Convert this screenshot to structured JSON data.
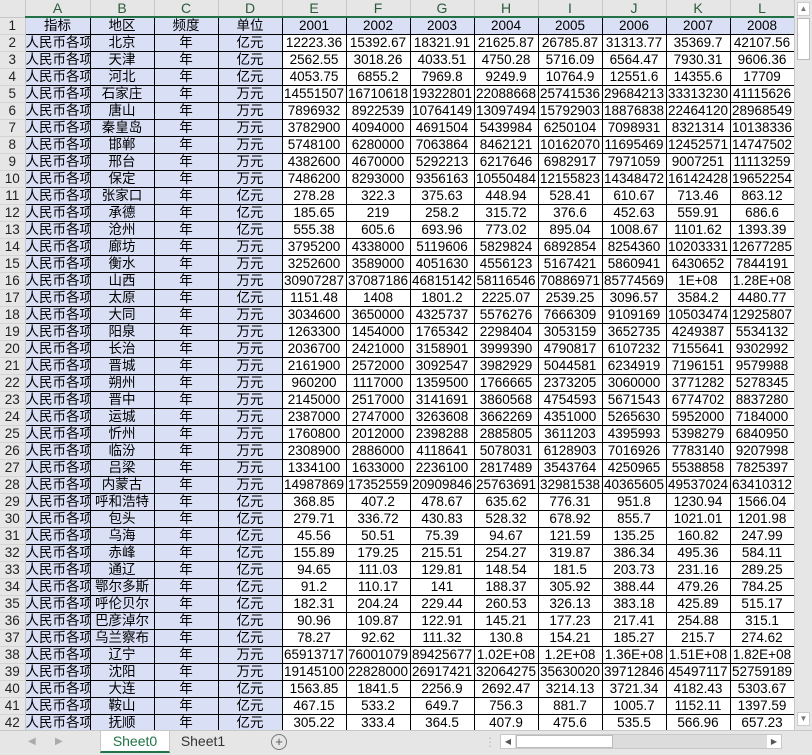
{
  "columns": [
    "A",
    "B",
    "C",
    "D",
    "E",
    "F",
    "G",
    "H",
    "I",
    "J",
    "K",
    "L"
  ],
  "header_row": [
    "指标",
    "地区",
    "频度",
    "单位",
    "2001",
    "2002",
    "2003",
    "2004",
    "2005",
    "2006",
    "2007",
    "2008"
  ],
  "rows": [
    [
      "人民币各项",
      "北京",
      "年",
      "亿元",
      "12223.36",
      "15392.67",
      "18321.91",
      "21625.87",
      "26785.87",
      "31313.77",
      "35369.7",
      "42107.56"
    ],
    [
      "人民币各项",
      "天津",
      "年",
      "亿元",
      "2562.55",
      "3018.26",
      "4033.51",
      "4750.28",
      "5716.09",
      "6564.47",
      "7930.31",
      "9606.36"
    ],
    [
      "人民币各项",
      "河北",
      "年",
      "亿元",
      "4053.75",
      "6855.2",
      "7969.8",
      "9249.9",
      "10764.9",
      "12551.6",
      "14355.6",
      "17709"
    ],
    [
      "人民币各项",
      "石家庄",
      "年",
      "万元",
      "14551507",
      "16710618",
      "19322801",
      "22088668",
      "25741536",
      "29684213",
      "33313230",
      "41115626"
    ],
    [
      "人民币各项",
      "唐山",
      "年",
      "万元",
      "7896932",
      "8922539",
      "10764149",
      "13097494",
      "15792903",
      "18876838",
      "22464120",
      "28968549"
    ],
    [
      "人民币各项",
      "秦皇岛",
      "年",
      "万元",
      "3782900",
      "4094000",
      "4691504",
      "5439984",
      "6250104",
      "7098931",
      "8321314",
      "10138336"
    ],
    [
      "人民币各项",
      "邯郸",
      "年",
      "万元",
      "5748100",
      "6280000",
      "7063864",
      "8462121",
      "10162070",
      "11695469",
      "12452571",
      "14747502"
    ],
    [
      "人民币各项",
      "邢台",
      "年",
      "万元",
      "4382600",
      "4670000",
      "5292213",
      "6217646",
      "6982917",
      "7971059",
      "9007251",
      "11113259"
    ],
    [
      "人民币各项",
      "保定",
      "年",
      "万元",
      "7486200",
      "8293000",
      "9356163",
      "10550484",
      "12155823",
      "14348472",
      "16142428",
      "19652254"
    ],
    [
      "人民币各项",
      "张家口",
      "年",
      "亿元",
      "278.28",
      "322.3",
      "375.63",
      "448.94",
      "528.41",
      "610.67",
      "713.46",
      "863.12"
    ],
    [
      "人民币各项",
      "承德",
      "年",
      "亿元",
      "185.65",
      "219",
      "258.2",
      "315.72",
      "376.6",
      "452.63",
      "559.91",
      "686.6"
    ],
    [
      "人民币各项",
      "沧州",
      "年",
      "亿元",
      "555.38",
      "605.6",
      "693.96",
      "773.02",
      "895.04",
      "1008.67",
      "1101.62",
      "1393.39"
    ],
    [
      "人民币各项",
      "廊坊",
      "年",
      "万元",
      "3795200",
      "4338000",
      "5119606",
      "5829824",
      "6892854",
      "8254360",
      "10203331",
      "12677285"
    ],
    [
      "人民币各项",
      "衡水",
      "年",
      "万元",
      "3252600",
      "3589000",
      "4051630",
      "4556123",
      "5167421",
      "5860941",
      "6430652",
      "7844191"
    ],
    [
      "人民币各项",
      "山西",
      "年",
      "万元",
      "30907287",
      "37087186",
      "46815142",
      "58116546",
      "70886971",
      "85774569",
      "1E+08",
      "1.28E+08"
    ],
    [
      "人民币各项",
      "太原",
      "年",
      "亿元",
      "1151.48",
      "1408",
      "1801.2",
      "2225.07",
      "2539.25",
      "3096.57",
      "3584.2",
      "4480.77"
    ],
    [
      "人民币各项",
      "大同",
      "年",
      "万元",
      "3034600",
      "3650000",
      "4325737",
      "5576276",
      "7666309",
      "9109169",
      "10503474",
      "12925807"
    ],
    [
      "人民币各项",
      "阳泉",
      "年",
      "万元",
      "1263300",
      "1454000",
      "1765342",
      "2298404",
      "3053159",
      "3652735",
      "4249387",
      "5534132"
    ],
    [
      "人民币各项",
      "长治",
      "年",
      "万元",
      "2036700",
      "2421000",
      "3158901",
      "3999390",
      "4790817",
      "6107232",
      "7155641",
      "9302992"
    ],
    [
      "人民币各项",
      "晋城",
      "年",
      "万元",
      "2161900",
      "2572000",
      "3092547",
      "3982929",
      "5044581",
      "6234919",
      "7196151",
      "9579988"
    ],
    [
      "人民币各项",
      "朔州",
      "年",
      "万元",
      "960200",
      "1117000",
      "1359500",
      "1766665",
      "2373205",
      "3060000",
      "3771282",
      "5278345"
    ],
    [
      "人民币各项",
      "晋中",
      "年",
      "万元",
      "2145000",
      "2517000",
      "3141691",
      "3860568",
      "4754593",
      "5671543",
      "6774702",
      "8837280"
    ],
    [
      "人民币各项",
      "运城",
      "年",
      "万元",
      "2387000",
      "2747000",
      "3263608",
      "3662269",
      "4351000",
      "5265630",
      "5952000",
      "7184000"
    ],
    [
      "人民币各项",
      "忻州",
      "年",
      "万元",
      "1760800",
      "2012000",
      "2398288",
      "2885805",
      "3611203",
      "4395993",
      "5398279",
      "6840950"
    ],
    [
      "人民币各项",
      "临汾",
      "年",
      "万元",
      "2308900",
      "2886000",
      "4118641",
      "5078031",
      "6128903",
      "7016926",
      "7783140",
      "9207998"
    ],
    [
      "人民币各项",
      "吕梁",
      "年",
      "万元",
      "1334100",
      "1633000",
      "2236100",
      "2817489",
      "3543764",
      "4250965",
      "5538858",
      "7825397"
    ],
    [
      "人民币各项",
      "内蒙古",
      "年",
      "万元",
      "14987869",
      "17352559",
      "20909846",
      "25763691",
      "32981538",
      "40365605",
      "49537024",
      "63410312"
    ],
    [
      "人民币各项",
      "呼和浩特",
      "年",
      "亿元",
      "368.85",
      "407.2",
      "478.67",
      "635.62",
      "776.31",
      "951.8",
      "1230.94",
      "1566.04"
    ],
    [
      "人民币各项",
      "包头",
      "年",
      "亿元",
      "279.71",
      "336.72",
      "430.83",
      "528.32",
      "678.92",
      "855.7",
      "1021.01",
      "1201.98"
    ],
    [
      "人民币各项",
      "乌海",
      "年",
      "亿元",
      "45.56",
      "50.51",
      "75.39",
      "94.67",
      "121.59",
      "135.25",
      "160.82",
      "247.99"
    ],
    [
      "人民币各项",
      "赤峰",
      "年",
      "亿元",
      "155.89",
      "179.25",
      "215.51",
      "254.27",
      "319.87",
      "386.34",
      "495.36",
      "584.11"
    ],
    [
      "人民币各项",
      "通辽",
      "年",
      "亿元",
      "94.65",
      "111.03",
      "129.81",
      "148.54",
      "181.5",
      "203.73",
      "231.16",
      "289.25"
    ],
    [
      "人民币各项",
      "鄂尔多斯",
      "年",
      "亿元",
      "91.2",
      "110.17",
      "141",
      "188.37",
      "305.92",
      "388.44",
      "479.26",
      "784.25"
    ],
    [
      "人民币各项",
      "呼伦贝尔",
      "年",
      "亿元",
      "182.31",
      "204.24",
      "229.44",
      "260.53",
      "326.13",
      "383.18",
      "425.89",
      "515.17"
    ],
    [
      "人民币各项",
      "巴彦淖尔",
      "年",
      "亿元",
      "90.96",
      "109.87",
      "122.91",
      "145.21",
      "177.23",
      "217.41",
      "254.88",
      "315.1"
    ],
    [
      "人民币各项",
      "乌兰察布",
      "年",
      "亿元",
      "78.27",
      "92.62",
      "111.32",
      "130.8",
      "154.21",
      "185.27",
      "215.7",
      "274.62"
    ],
    [
      "人民币各项",
      "辽宁",
      "年",
      "万元",
      "65913717",
      "76001079",
      "89425677",
      "1.02E+08",
      "1.2E+08",
      "1.36E+08",
      "1.51E+08",
      "1.82E+08"
    ],
    [
      "人民币各项",
      "沈阳",
      "年",
      "万元",
      "19145100",
      "22828000",
      "26917421",
      "32064275",
      "35630020",
      "39712846",
      "45497117",
      "52759189"
    ],
    [
      "人民币各项",
      "大连",
      "年",
      "亿元",
      "1563.85",
      "1841.5",
      "2256.9",
      "2692.47",
      "3214.13",
      "3721.34",
      "4182.43",
      "5303.67"
    ],
    [
      "人民币各项",
      "鞍山",
      "年",
      "亿元",
      "467.15",
      "533.2",
      "649.7",
      "756.3",
      "881.7",
      "1005.7",
      "1152.11",
      "1397.59"
    ],
    [
      "人民币各项",
      "抚顺",
      "年",
      "亿元",
      "305.22",
      "333.4",
      "364.5",
      "407.9",
      "475.6",
      "535.5",
      "566.96",
      "657.23"
    ]
  ],
  "sheets": [
    "Sheet0",
    "Sheet1"
  ],
  "active_sheet": "Sheet0",
  "add_sheet_icon": "+",
  "colors": {
    "accent": "#217346",
    "label_fill": "#d9dff5"
  }
}
